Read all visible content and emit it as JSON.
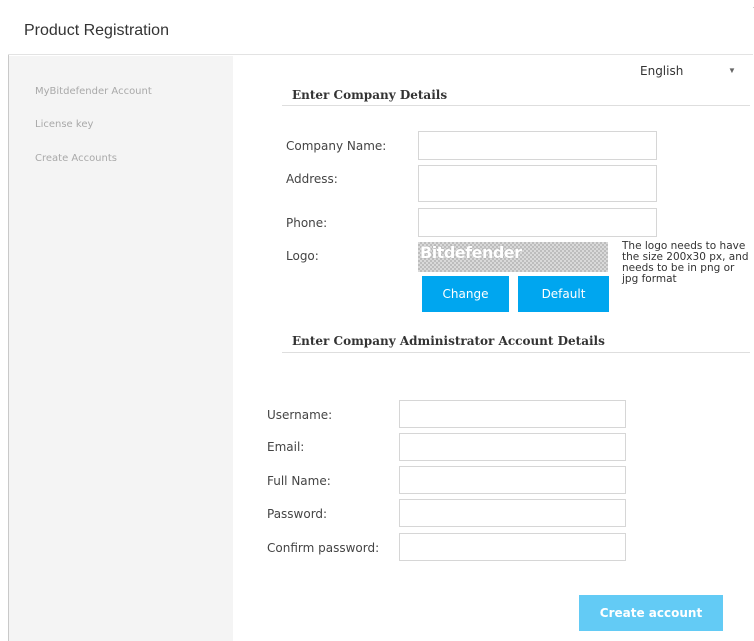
{
  "window": {
    "title": "Product Registration"
  },
  "sidebar": {
    "items": [
      {
        "label": "MyBitdefender Account"
      },
      {
        "label": "License key"
      },
      {
        "label": "Create Accounts"
      }
    ]
  },
  "language": {
    "selected": "English",
    "arrow": "▼"
  },
  "company": {
    "section_title": "Enter Company Details",
    "name_label": "Company Name:",
    "address_label": "Address:",
    "phone_label": "Phone:",
    "logo_label": "Logo:",
    "logo_text": "Bitdefender",
    "logo_note": "The logo needs to have the size 200x30 px, and needs to be in png or jpg format",
    "change_button": "Change",
    "default_button": "Default",
    "name_value": "",
    "address_value": "",
    "phone_value": ""
  },
  "admin": {
    "section_title": "Enter Company Administrator Account Details",
    "username_label": "Username:",
    "email_label": "Email:",
    "fullname_label": "Full Name:",
    "password_label": "Password:",
    "confirm_label": "Confirm password:",
    "username_value": "",
    "email_value": "",
    "fullname_value": "",
    "password_value": "",
    "confirm_value": "",
    "create_button": "Create account"
  },
  "colors": {
    "accent": "#00a6ef",
    "accent_disabled": "#63cbf5",
    "sidebar_bg": "#f4f4f4"
  }
}
